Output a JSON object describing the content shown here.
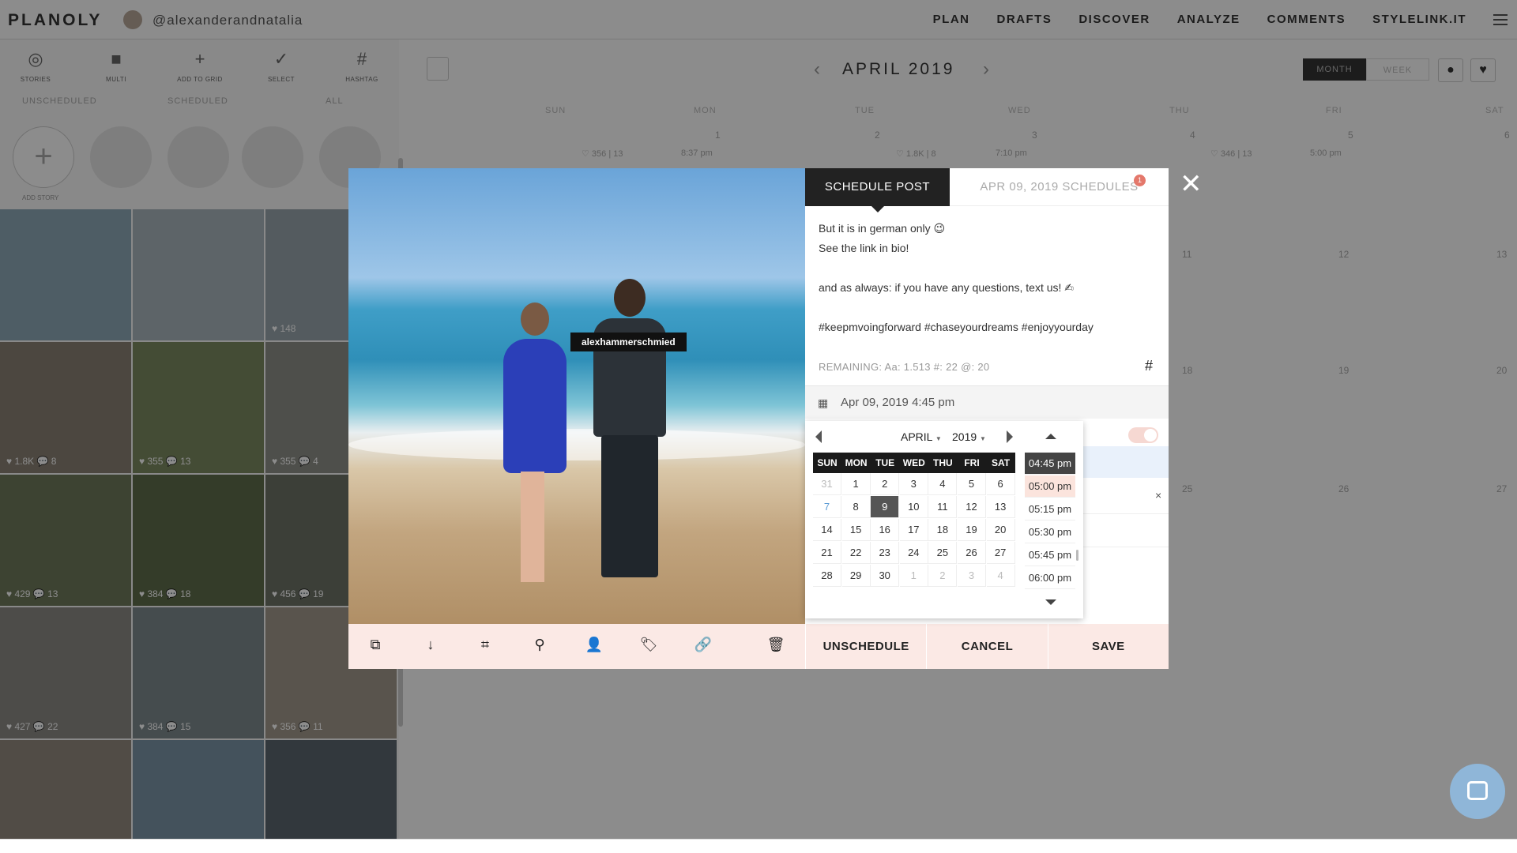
{
  "nav": {
    "logo": "PLANOLY",
    "account": "@alexanderandnatalia",
    "links": [
      "PLAN",
      "DRAFTS",
      "DISCOVER",
      "ANALYZE",
      "COMMENTS",
      "STYLELINK.IT"
    ]
  },
  "sidebar": {
    "tools": [
      "STORIES",
      "MULTI",
      "ADD TO GRID",
      "SELECT",
      "HASHTAG"
    ],
    "tabs": [
      "UNSCHEDULED",
      "SCHEDULED",
      "ALL"
    ],
    "add_story": "ADD STORY",
    "tile_stats": [
      "",
      "",
      "♥ 148",
      "♥ 1.8K  💬 8",
      "♥ 355  💬 13",
      "♥ 355  💬 4",
      "♥ 429  💬 13",
      "♥ 384  💬 18",
      "♥ 456  💬 19",
      "♥ 427  💬 22",
      "♥ 384  💬 15",
      "♥ 356  💬 11",
      "",
      "",
      ""
    ]
  },
  "calendar": {
    "month": "APRIL 2019",
    "views": [
      "MONTH",
      "WEEK"
    ],
    "daynames": [
      "SUN",
      "MON",
      "TUE",
      "WED",
      "THU",
      "FRI",
      "SAT"
    ],
    "week1_dates": [
      "1",
      "2",
      "3",
      "4",
      "5",
      "6"
    ],
    "week1_stats": [
      "♡ 356 | 13",
      "8:37 pm",
      "♡ 1.8K | 8",
      "7:10 pm",
      "♡ 346 | 13",
      "5:00 pm"
    ],
    "row_dates": [
      "11",
      "12",
      "13",
      "18",
      "19",
      "20",
      "25",
      "26",
      "27"
    ]
  },
  "modal": {
    "user_tag": "alexhammerschmied",
    "tabs": {
      "active": "SCHEDULE POST",
      "inactive": "APR 09, 2019 SCHEDULES",
      "badge": "1"
    },
    "caption": [
      "But it is in german only 😉",
      "See the link in bio!",
      "",
      "and as always: if you have any questions, text us! ✍",
      "",
      "#keepmvoingforward #chaseyourdreams #enjoyyourday"
    ],
    "remaining": "REMAINING: Aa: 1.513   #: 22   @: 20",
    "hash_symbol": "#",
    "scheduled_date": "Apr 09, 2019 4:45 pm",
    "actions": {
      "unschedule": "UNSCHEDULE",
      "cancel": "CANCEL",
      "save": "SAVE"
    },
    "close": "✕",
    "remove": "×"
  },
  "picker": {
    "month": "APRIL",
    "year": "2019",
    "days": [
      "SUN",
      "MON",
      "TUE",
      "WED",
      "THU",
      "FRI",
      "SAT"
    ],
    "dates": [
      [
        "31",
        "1",
        "2",
        "3",
        "4",
        "5",
        "6"
      ],
      [
        "7",
        "8",
        "9",
        "10",
        "11",
        "12",
        "13"
      ],
      [
        "14",
        "15",
        "16",
        "17",
        "18",
        "19",
        "20"
      ],
      [
        "21",
        "22",
        "23",
        "24",
        "25",
        "26",
        "27"
      ],
      [
        "28",
        "29",
        "30",
        "1",
        "2",
        "3",
        "4"
      ]
    ],
    "selected_date": "9",
    "times": [
      "04:45 pm",
      "05:00 pm",
      "05:15 pm",
      "05:30 pm",
      "05:45 pm",
      "06:00 pm"
    ],
    "selected_time": "04:45 pm",
    "hover_time": "05:00 pm"
  },
  "colors": {
    "accent": "#e4786b",
    "pink_bar": "#fbe9e5",
    "dark": "#222222"
  }
}
